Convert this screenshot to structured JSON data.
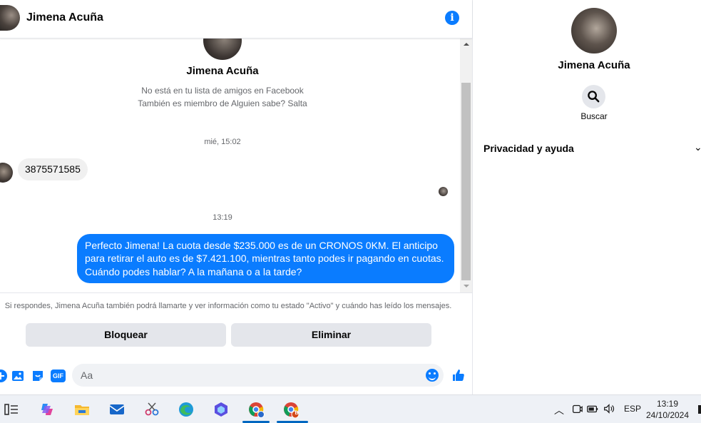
{
  "header": {
    "contact_name": "Jimena Acuña"
  },
  "profile": {
    "name": "Jimena Acuña",
    "line1": "No está en tu lista de amigos en Facebook",
    "line2": "También es miembro de Alguien sabe? Salta"
  },
  "messages": [
    {
      "timestamp": "mié, 15:02",
      "direction": "incoming",
      "text": "3875571585"
    },
    {
      "timestamp": "13:19",
      "direction": "outgoing",
      "text": "Perfecto Jimena!  La cuota desde $235.000 es de un CRONOS 0KM. El anticipo para retirar el auto es de $7.421.100, mientras tanto podes ir pagando en cuotas. Cuándo podes hablar? A la mañana o a la tarde?"
    }
  ],
  "notice": "Si respondes, Jimena Acuña también podrá llamarte y ver información como tu estado \"Activo\" y cuándo has leído los mensajes.",
  "actions": {
    "block_label": "Bloquear",
    "delete_label": "Eliminar"
  },
  "composer": {
    "placeholder": "Aa",
    "gif_label": "GIF"
  },
  "sidebar": {
    "name": "Jimena Acuña",
    "search_label": "Buscar",
    "section_label": "Privacidad y ayuda"
  },
  "taskbar": {
    "language": "ESP",
    "time": "13:19",
    "date": "24/10/2024",
    "badge": "B"
  },
  "colors": {
    "accent": "#0a7cff",
    "bubble_in": "#f0f0f0",
    "button_bg": "#e4e6eb"
  }
}
